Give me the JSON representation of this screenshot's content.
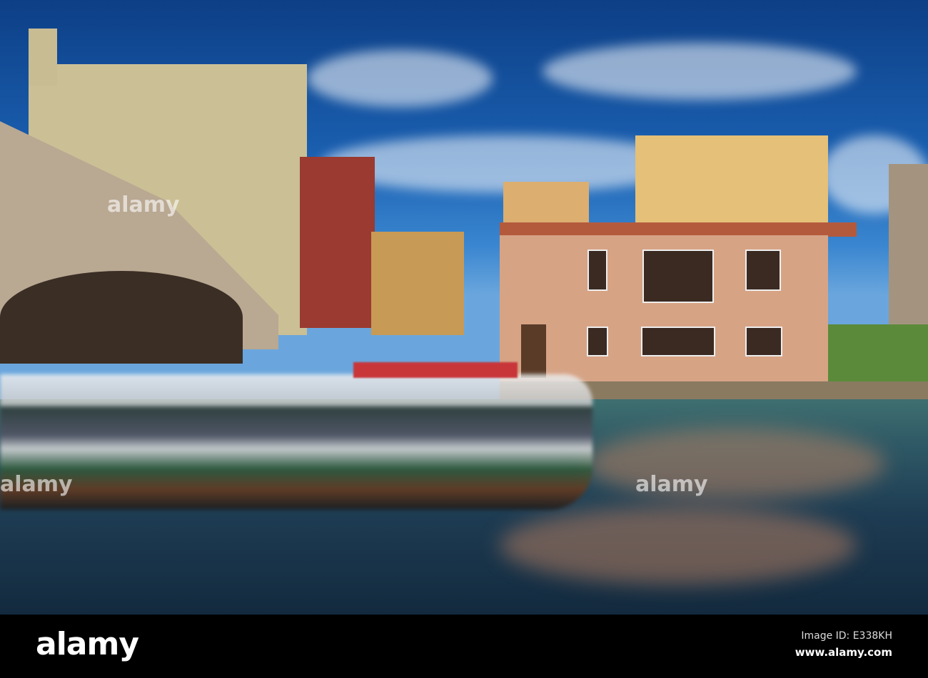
{
  "watermark": {
    "brand": "alamy"
  },
  "footer": {
    "logo": "alamy",
    "image_id": "Image ID: E338KH",
    "url": "www.alamy.com"
  },
  "colors": {
    "sky": "#1a5fb0",
    "water": "#1d3b52",
    "footer": "#000000"
  }
}
